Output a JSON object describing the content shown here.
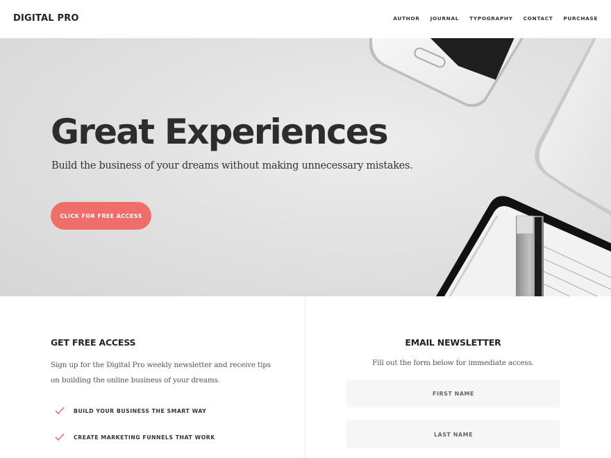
{
  "header": {
    "logo": "DIGITAL PRO",
    "nav": [
      "AUTHOR",
      "JOURNAL",
      "TYPOGRAPHY",
      "CONTACT",
      "PURCHASE"
    ]
  },
  "hero": {
    "title": "Great Experiences",
    "subtitle": "Build the business of your dreams without making unnecessary mistakes.",
    "cta_label": "CLICK FOR FREE ACCESS",
    "cta_color": "#ef6e6a",
    "image_description": "smartphone, laptop, notebook and pen on white desk"
  },
  "free_access": {
    "title": "GET FREE ACCESS",
    "text": "Sign up for the Digital Pro weekly newsletter and receive tips on building the online business of your dreams.",
    "items": [
      {
        "icon": "check-icon",
        "label": "BUILD YOUR BUSINESS THE SMART WAY"
      },
      {
        "icon": "check-icon",
        "label": "CREATE MARKETING FUNNELS THAT WORK"
      }
    ]
  },
  "newsletter": {
    "title": "EMAIL NEWSLETTER",
    "text": "Fill out the form below for immediate access.",
    "first_name_placeholder": "FIRST NAME",
    "last_name_placeholder": "LAST NAME"
  }
}
